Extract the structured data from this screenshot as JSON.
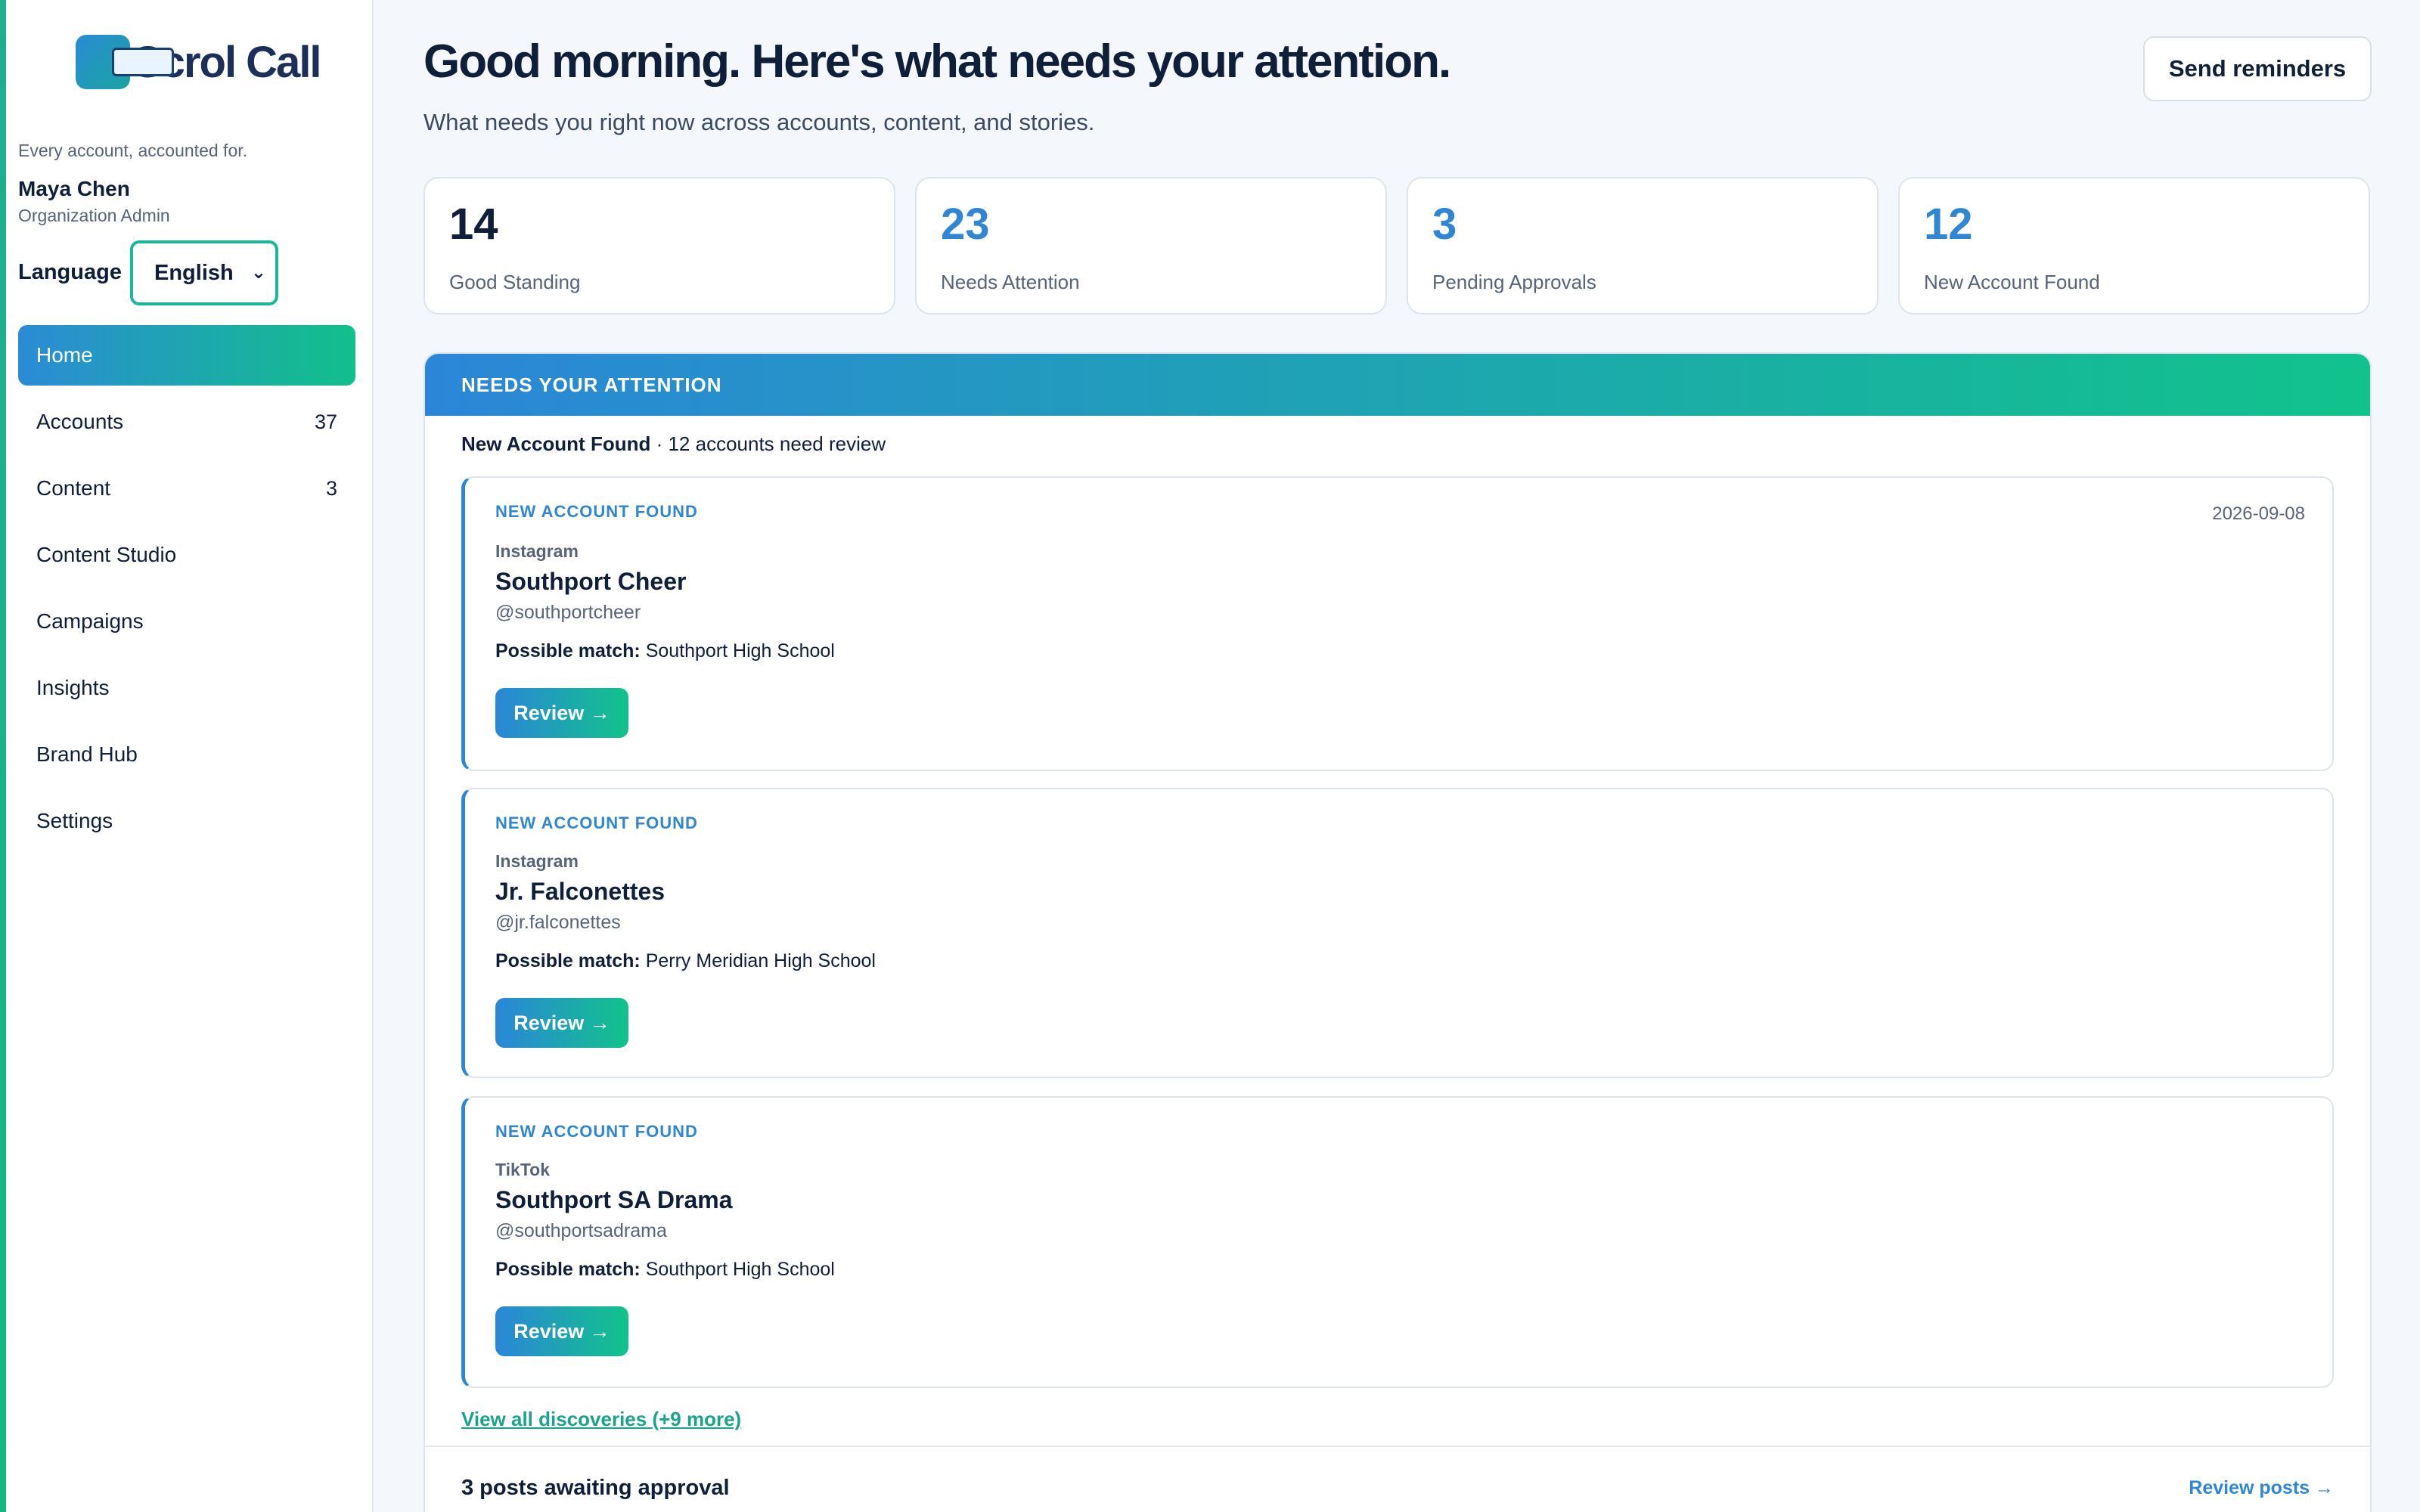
{
  "brand": {
    "name": "ScrollCall",
    "logo_text": "Scrol Call",
    "tagline": "Every account, accounted for.",
    "accent": "#2e86d4",
    "accent2": "#11c38b"
  },
  "user": {
    "name": "Maya Chen",
    "role": "Organization Admin"
  },
  "language": {
    "label": "Language",
    "selected": "English"
  },
  "nav": [
    {
      "label": "Home",
      "count": "",
      "active": true
    },
    {
      "label": "Accounts",
      "count": "37"
    },
    {
      "label": "Content",
      "count": "3"
    },
    {
      "label": "Content Studio",
      "count": ""
    },
    {
      "label": "Campaigns",
      "count": ""
    },
    {
      "label": "Insights",
      "count": ""
    },
    {
      "label": "Brand Hub",
      "count": ""
    },
    {
      "label": "Settings",
      "count": ""
    }
  ],
  "header": {
    "title": "Good morning. Here's what needs your attention.",
    "subtitle": "What needs you right now across accounts, content, and stories.",
    "send_reminders": "Send reminders"
  },
  "stats": [
    {
      "value": "14",
      "label": "Good Standing"
    },
    {
      "value": "23",
      "label": "Needs Attention"
    },
    {
      "value": "3",
      "label": "Pending Approvals"
    },
    {
      "value": "12",
      "label": "New Account Found"
    }
  ],
  "attention": {
    "heading": "NEEDS YOUR ATTENTION",
    "section_title": "New Account Found",
    "section_detail": " · 12 accounts need review",
    "match_label": "Possible match:",
    "review_label": "Review →",
    "cards": [
      {
        "kind": "NEW ACCOUNT FOUND",
        "date": "2026-09-08",
        "platform": "Instagram",
        "name": "Southport Cheer",
        "handle": "@southportcheer",
        "match": "Southport High School"
      },
      {
        "kind": "NEW ACCOUNT FOUND",
        "date": "",
        "platform": "Instagram",
        "name": "Jr. Falconettes",
        "handle": "@jr.falconettes",
        "match": "Perry Meridian High School"
      },
      {
        "kind": "NEW ACCOUNT FOUND",
        "date": "",
        "platform": "TikTok",
        "name": "Southport SA Drama",
        "handle": "@southportsadrama",
        "match": "Southport High School"
      }
    ],
    "view_all": "View all discoveries (+9 more)",
    "posts_title": "3 posts awaiting approval",
    "review_posts": "Review posts →"
  }
}
